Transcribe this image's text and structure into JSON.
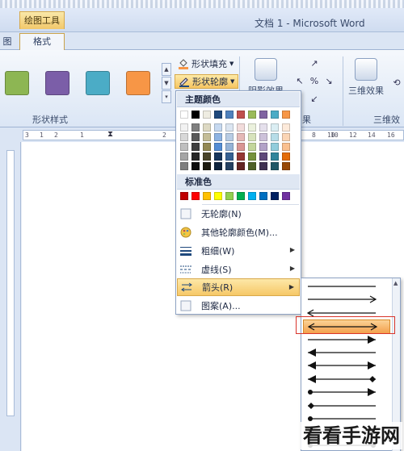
{
  "titlebar": {
    "tools_tab": "绘图工具",
    "document_title": "文档 1 - Microsoft Word"
  },
  "tabs": {
    "left_partial": "图",
    "format": "格式"
  },
  "ribbon": {
    "shape_styles_label": "形状样式",
    "swatches": [
      "#8db653",
      "#7b5ea8",
      "#4bacc6",
      "#f79646"
    ],
    "shape_fill": "形状填充",
    "shape_outline": "形状轮廓",
    "shadow_effects": "阴影效果",
    "shadow_group_partial": "果",
    "three_d_effects": "三维效果",
    "three_d_group": "三维效果"
  },
  "ruler": {
    "marks": [
      "3",
      "1",
      "2",
      "1",
      "2",
      "8",
      "10",
      "6",
      "8",
      "10",
      "12",
      "14",
      "16"
    ]
  },
  "menu": {
    "theme_colors_label": "主题颜色",
    "standard_colors_label": "标准色",
    "theme_top_row": [
      "#ffffff",
      "#000000",
      "#eeece1",
      "#1f497d",
      "#4f81bd",
      "#c0504d",
      "#9bbb59",
      "#8064a2",
      "#4bacc6",
      "#f79646"
    ],
    "theme_shades": [
      [
        "#f2f2f2",
        "#7f7f7f",
        "#ddd9c3",
        "#c6d9f0",
        "#dbe5f1",
        "#f2dcdb",
        "#ebf1dd",
        "#e5e0ec",
        "#dbeef3",
        "#fdeada"
      ],
      [
        "#d8d8d8",
        "#595959",
        "#c4bd97",
        "#8db3e2",
        "#b8cce4",
        "#e5b9b7",
        "#d7e3bc",
        "#ccc1d9",
        "#b7dde8",
        "#fbd5b5"
      ],
      [
        "#bfbfbf",
        "#3f3f3f",
        "#938953",
        "#548dd4",
        "#95b3d7",
        "#d99694",
        "#c3d69b",
        "#b2a2c7",
        "#92cddc",
        "#fac08f"
      ],
      [
        "#a5a5a5",
        "#262626",
        "#494429",
        "#17365d",
        "#366092",
        "#953734",
        "#76923c",
        "#5f497a",
        "#31859b",
        "#e36c09"
      ],
      [
        "#7f7f7f",
        "#0c0c0c",
        "#1d1b10",
        "#0f243e",
        "#244061",
        "#632423",
        "#4f6128",
        "#3f3151",
        "#205867",
        "#974806"
      ]
    ],
    "standard_colors": [
      "#c00000",
      "#ff0000",
      "#ffc000",
      "#ffff00",
      "#92d050",
      "#00b050",
      "#00b0f0",
      "#0070c0",
      "#002060",
      "#7030a0"
    ],
    "items": {
      "no_outline": "无轮廓(N)",
      "more_colors": "其他轮廓颜色(M)...",
      "weight": "粗细(W)",
      "dashes": "虚线(S)",
      "arrows": "箭头(R)",
      "pattern": "图案(A)..."
    }
  },
  "submenu": {
    "arrow_styles": [
      "line",
      "right-arrow",
      "left-arrow",
      "double-arrow",
      "right-thick-arrow",
      "left-thick-arrow",
      "double-thick-arrow",
      "left-arrow-diamond-end",
      "double-arrow-dots",
      "diamond-line",
      "circle-line",
      "diamond-both",
      "circle-both"
    ],
    "selected_index": 3
  },
  "watermark": "看看手游网"
}
